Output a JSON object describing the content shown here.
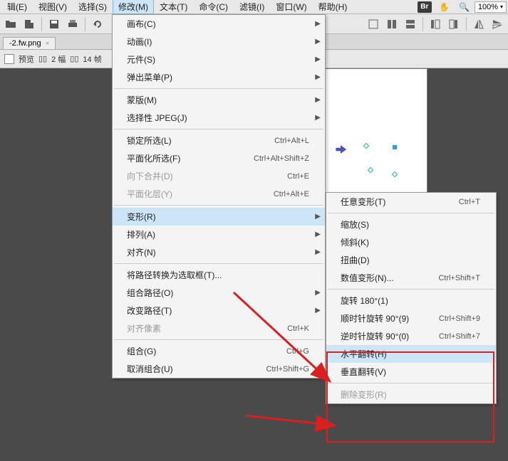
{
  "menubar": {
    "items": [
      "辑(E)",
      "视图(V)",
      "选择(S)",
      "修改(M)",
      "文本(T)",
      "命令(C)",
      "滤镜(I)",
      "窗口(W)",
      "帮助(H)"
    ],
    "open_index": 3,
    "zoom": "100%"
  },
  "doctab": {
    "title": "-2.fw.png"
  },
  "optbar": {
    "preview": "预览",
    "two": "2 幅",
    "four": "14 帧"
  },
  "menu1": [
    {
      "label": "画布(C)",
      "sub": true
    },
    {
      "label": "动画(I)",
      "sub": true
    },
    {
      "label": "元件(S)",
      "sub": true
    },
    {
      "label": "弹出菜单(P)",
      "sub": true
    },
    {
      "sep": true
    },
    {
      "label": "蒙版(M)",
      "sub": true
    },
    {
      "label": "选择性 JPEG(J)",
      "sub": true
    },
    {
      "sep": true
    },
    {
      "label": "锁定所选(L)",
      "short": "Ctrl+Alt+L"
    },
    {
      "label": "平面化所选(F)",
      "short": "Ctrl+Alt+Shift+Z"
    },
    {
      "label": "向下合并(D)",
      "short": "Ctrl+E",
      "disabled": true
    },
    {
      "label": "平面化层(Y)",
      "short": "Ctrl+Alt+E",
      "disabled": true
    },
    {
      "sep": true
    },
    {
      "label": "变形(R)",
      "sub": true,
      "hover": true
    },
    {
      "label": "排列(A)",
      "sub": true
    },
    {
      "label": "对齐(N)",
      "sub": true
    },
    {
      "sep": true
    },
    {
      "label": "将路径转换为选取框(T)..."
    },
    {
      "label": "组合路径(O)",
      "sub": true
    },
    {
      "label": "改变路径(T)",
      "sub": true
    },
    {
      "label": "对齐像素",
      "short": "Ctrl+K",
      "disabled": true
    },
    {
      "sep": true
    },
    {
      "label": "组合(G)",
      "short": "Ctrl+G"
    },
    {
      "label": "取消组合(U)",
      "short": "Ctrl+Shift+G"
    }
  ],
  "menu2": [
    {
      "label": "任意变形(T)",
      "short": "Ctrl+T"
    },
    {
      "sep": true
    },
    {
      "label": "缩放(S)"
    },
    {
      "label": "倾斜(K)"
    },
    {
      "label": "扭曲(D)"
    },
    {
      "label": "数值变形(N)...",
      "short": "Ctrl+Shift+T"
    },
    {
      "sep": true
    },
    {
      "label": "旋转 180°(1)"
    },
    {
      "label": "顺时针旋转 90°(9)",
      "short": "Ctrl+Shift+9"
    },
    {
      "label": "逆时针旋转 90°(0)",
      "short": "Ctrl+Shift+7"
    },
    {
      "label": "水平翻转(H)",
      "hover": true
    },
    {
      "label": "垂直翻转(V)"
    },
    {
      "sep": true
    },
    {
      "label": "删除变形(R)",
      "disabled": true
    }
  ]
}
